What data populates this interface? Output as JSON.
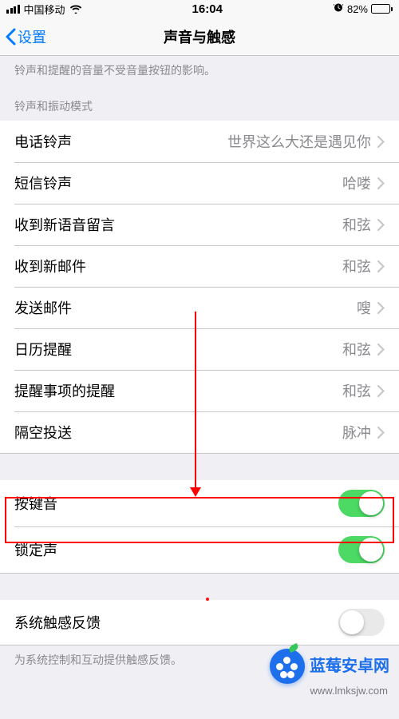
{
  "statusbar": {
    "carrier": "中国移动",
    "time": "16:04",
    "battery_pct": "82%",
    "battery_fill": 82
  },
  "nav": {
    "back_label": "设置",
    "title": "声音与触感"
  },
  "hint_top": "铃声和提醒的音量不受音量按钮的影响。",
  "section_header": "铃声和振动模式",
  "rows": [
    {
      "label": "电话铃声",
      "value": "世界这么大还是遇见你"
    },
    {
      "label": "短信铃声",
      "value": "哈喽"
    },
    {
      "label": "收到新语音留言",
      "value": "和弦"
    },
    {
      "label": "收到新邮件",
      "value": "和弦"
    },
    {
      "label": "发送邮件",
      "value": "嗖"
    },
    {
      "label": "日历提醒",
      "value": "和弦"
    },
    {
      "label": "提醒事项的提醒",
      "value": "和弦"
    },
    {
      "label": "隔空投送",
      "value": "脉冲"
    }
  ],
  "toggles": [
    {
      "label": "按键音",
      "on": true
    },
    {
      "label": "锁定声",
      "on": true
    }
  ],
  "toggle2": {
    "label": "系统触感反馈",
    "on": false
  },
  "footer": "为系统控制和互动提供触感反馈。",
  "watermark": {
    "brand": "蓝莓安卓网",
    "url": "www.lmksjw.com"
  }
}
